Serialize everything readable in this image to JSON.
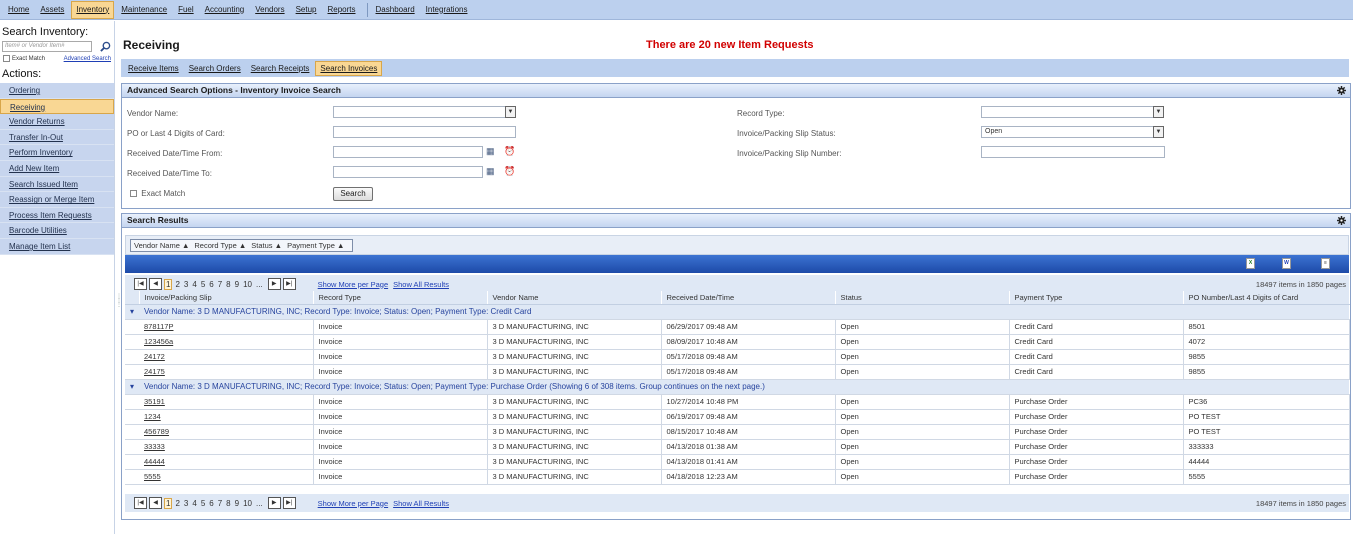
{
  "topnav": [
    "Home",
    "Assets",
    "Inventory",
    "Maintenance",
    "Fuel",
    "Accounting",
    "Vendors",
    "Setup",
    "Reports",
    "Dashboard",
    "Integrations"
  ],
  "topnav_active": "Inventory",
  "sidebar": {
    "search_title": "Search Inventory:",
    "search_placeholder": "Item# or Vendor Item#",
    "exact_match": "Exact Match",
    "advanced_search": "Advanced Search",
    "actions_title": "Actions:",
    "actions": [
      "Ordering",
      "Receiving",
      "Vendor Returns",
      "Transfer In-Out",
      "Perform Inventory",
      "Add New Item",
      "Search Issued Item",
      "Reassign or Merge Item",
      "Process Item Requests",
      "Barcode Utilities",
      "Manage Item List"
    ],
    "active_action": "Receiving"
  },
  "page": {
    "title": "Receiving",
    "alert": "There are 20 new Item Requests",
    "tabs": [
      "Receive Items",
      "Search Orders",
      "Search Receipts",
      "Search Invoices"
    ],
    "active_tab": "Search Invoices"
  },
  "adv_search": {
    "title": "Advanced Search Options - Inventory Invoice Search",
    "vendor_name": "Vendor Name:",
    "po_digits": "PO or Last 4 Digits of Card:",
    "received_from": "Received Date/Time From:",
    "received_to": "Received Date/Time To:",
    "exact_match": "Exact Match",
    "search_btn": "Search",
    "record_type": "Record Type:",
    "status_label": "Invoice/Packing Slip Status:",
    "status_value": "Open",
    "slip_number": "Invoice/Packing Slip Number:"
  },
  "results": {
    "title": "Search Results",
    "group_chips": [
      "Vendor Name ▲",
      "Record Type ▲",
      "Status ▲",
      "Payment Type ▲"
    ],
    "pager_pages": [
      "1",
      "2",
      "3",
      "4",
      "5",
      "6",
      "7",
      "8",
      "9",
      "10",
      "..."
    ],
    "show_more": "Show More per Page",
    "show_all": "Show All Results",
    "count": "18497 items in 1850 pages",
    "columns": [
      "Invoice/Packing Slip",
      "Record Type",
      "Vendor Name",
      "Received Date/Time",
      "Status",
      "Payment Type",
      "PO Number/Last 4 Digits of Card"
    ],
    "groups": [
      {
        "label": "Vendor Name: 3 D MANUFACTURING, INC; Record Type: Invoice; Status: Open; Payment Type: Credit Card",
        "rows": [
          [
            "878117P",
            "Invoice",
            "3 D MANUFACTURING, INC",
            "06/29/2017 09:48 AM",
            "Open",
            "Credit Card",
            "8501"
          ],
          [
            "123456a",
            "Invoice",
            "3 D MANUFACTURING, INC",
            "08/09/2017 10:48 AM",
            "Open",
            "Credit Card",
            "4072"
          ],
          [
            "24172",
            "Invoice",
            "3 D MANUFACTURING, INC",
            "05/17/2018 09:48 AM",
            "Open",
            "Credit Card",
            "9855"
          ],
          [
            "24175",
            "Invoice",
            "3 D MANUFACTURING, INC",
            "05/17/2018 09:48 AM",
            "Open",
            "Credit Card",
            "9855"
          ]
        ]
      },
      {
        "label": "Vendor Name: 3 D MANUFACTURING, INC; Record Type: Invoice; Status: Open; Payment Type: Purchase Order (Showing 6 of 308 items. Group continues on the next page.)",
        "rows": [
          [
            "35191",
            "Invoice",
            "3 D MANUFACTURING, INC",
            "10/27/2014 10:48 PM",
            "Open",
            "Purchase Order",
            "PC36"
          ],
          [
            "1234",
            "Invoice",
            "3 D MANUFACTURING, INC",
            "06/19/2017 09:48 AM",
            "Open",
            "Purchase Order",
            "PO TEST"
          ],
          [
            "456789",
            "Invoice",
            "3 D MANUFACTURING, INC",
            "08/15/2017 10:48 AM",
            "Open",
            "Purchase Order",
            "PO TEST"
          ],
          [
            "33333",
            "Invoice",
            "3 D MANUFACTURING, INC",
            "04/13/2018 01:38 AM",
            "Open",
            "Purchase Order",
            "333333"
          ],
          [
            "44444",
            "Invoice",
            "3 D MANUFACTURING, INC",
            "04/13/2018 01:41 AM",
            "Open",
            "Purchase Order",
            "44444"
          ],
          [
            "5555",
            "Invoice",
            "3 D MANUFACTURING, INC",
            "04/18/2018 12:23 AM",
            "Open",
            "Purchase Order",
            "5555"
          ]
        ]
      }
    ]
  }
}
